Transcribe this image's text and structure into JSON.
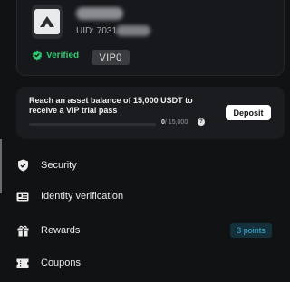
{
  "profile": {
    "uid_label": "UID: 7031",
    "verified_label": "Verified",
    "vip_label": "VIP0"
  },
  "promo": {
    "message": "Reach an asset balance of 15,000 USDT to receive a VIP trial pass",
    "progress_current": "0",
    "progress_target": "/ 15,000",
    "progress_fraction": 0,
    "help_glyph": "?",
    "deposit_label": "Deposit"
  },
  "nav": {
    "items": [
      {
        "label": "Security",
        "icon": "shield-icon"
      },
      {
        "label": "Identity verification",
        "icon": "id-card-icon"
      },
      {
        "label": "Rewards",
        "icon": "gift-icon",
        "badge": "3 points"
      },
      {
        "label": "Coupons",
        "icon": "coupon-icon"
      }
    ]
  },
  "colors": {
    "background": "#111214",
    "verified": "#33c873",
    "badge_text": "#3fb6d9",
    "progress": "#2d9cdb"
  }
}
